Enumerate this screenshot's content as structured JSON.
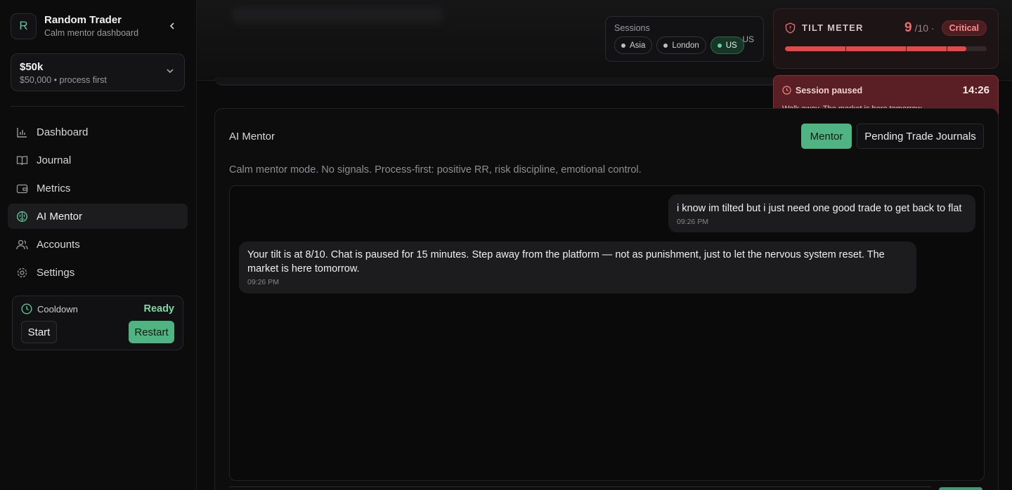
{
  "brand": {
    "initial": "R",
    "name": "Random Trader",
    "subtitle": "Calm mentor dashboard"
  },
  "account": {
    "title": "$50k",
    "subtitle": "$50,000 • process first"
  },
  "nav": [
    {
      "label": "Dashboard",
      "icon": "bar-chart-icon"
    },
    {
      "label": "Journal",
      "icon": "book-icon"
    },
    {
      "label": "Metrics",
      "icon": "wallet-icon"
    },
    {
      "label": "AI Mentor",
      "icon": "brain-icon",
      "active": true
    },
    {
      "label": "Accounts",
      "icon": "users-icon"
    },
    {
      "label": "Settings",
      "icon": "gear-icon"
    }
  ],
  "cooldown": {
    "label": "Cooldown",
    "status": "Ready",
    "start": "Start",
    "restart": "Restart"
  },
  "sessions": {
    "label": "Sessions",
    "chips": [
      "Asia",
      "London",
      "US"
    ],
    "active": "US",
    "current": "US"
  },
  "tilt": {
    "title": "TILT METER",
    "score": "9",
    "max": "/10 ·",
    "badge": "Critical",
    "fill_fraction": 0.9
  },
  "pause": {
    "title": "Session paused",
    "time": "14:26",
    "message": "Walk away. The market is here tomorrow."
  },
  "panel": {
    "title": "AI Mentor",
    "tab_mentor": "Mentor",
    "tab_pending": "Pending Trade Journals",
    "description": "Calm mentor mode. No signals. Process-first: positive RR, risk discipline, emotional control."
  },
  "messages": [
    {
      "role": "user",
      "text": "i know im tilted but i just need one good trade to get back to flat",
      "time": "09:26 PM"
    },
    {
      "role": "assistant",
      "text": "Your tilt is at 8/10. Chat is paused for 15 minutes. Step away from the platform — not as punishment, just to let the nervous system reset. The market is here tomorrow.",
      "time": "09:26 PM"
    }
  ],
  "colors": {
    "accent": "#4fb482",
    "danger": "#e84848",
    "background": "#0b0b0c"
  }
}
